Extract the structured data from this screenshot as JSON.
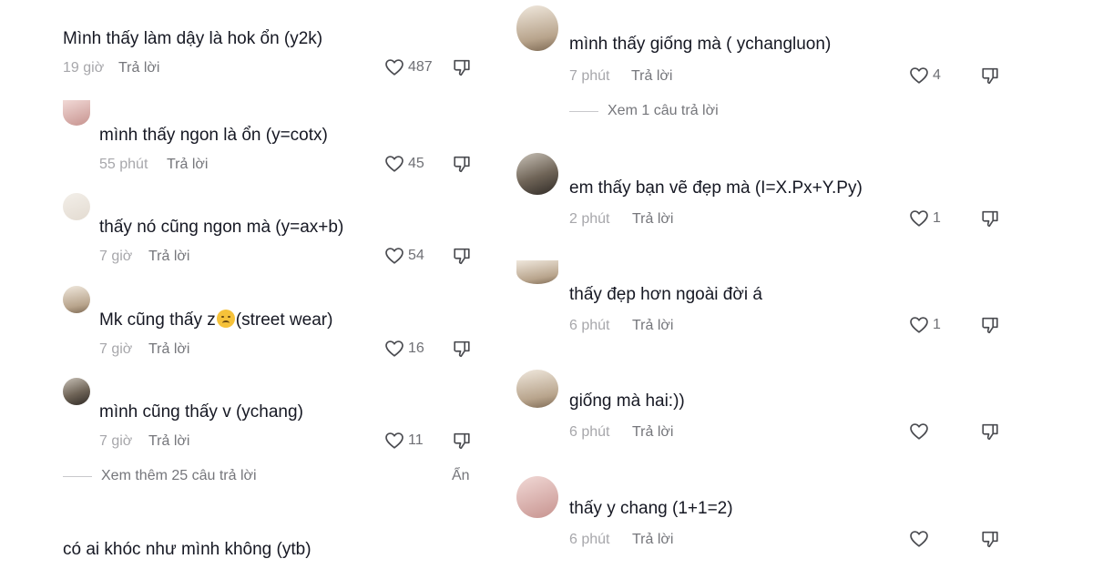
{
  "left": {
    "comments": [
      {
        "text": "Mình thấy làm dậy là hok ổn (y2k)",
        "time": "19 giờ",
        "reply": "Trả lời",
        "likes": "487"
      },
      {
        "text": "mình thấy ngon là ổn (y=cotx)",
        "time": "55 phút",
        "reply": "Trả lời",
        "likes": "45"
      },
      {
        "text": "thấy nó cũng ngon mà (y=ax+b)",
        "time": "7 giờ",
        "reply": "Trả lời",
        "likes": "54"
      },
      {
        "text_before": "Mk cũng thấy z",
        "text_after": "(street wear)",
        "emoji": "disappointed-face",
        "time": "7 giờ",
        "reply": "Trả lời",
        "likes": "16"
      },
      {
        "text": "mình cũng thấy v (ychang)",
        "time": "7 giờ",
        "reply": "Trả lời",
        "likes": "11"
      }
    ],
    "view_more": "Xem thêm 25 câu trả lời",
    "hide": "Ẩn",
    "bottom_comment": {
      "text": "có ai khóc như mình không (ytb)"
    }
  },
  "right": {
    "comments": [
      {
        "text": "mình thấy giống mà ( ychangluon)",
        "time": "7 phút",
        "reply": "Trả lời",
        "likes": "4"
      },
      {
        "text": "em thấy bạn vẽ đẹp mà (I=X.Px+Y.Py)",
        "time": "2 phút",
        "reply": "Trả lời",
        "likes": "1"
      },
      {
        "text": "thấy đẹp hơn ngoài đời á",
        "time": "6 phút",
        "reply": "Trả lời",
        "likes": "1"
      },
      {
        "text": "giống mà hai:))",
        "time": "6 phút",
        "reply": "Trả lời",
        "likes": ""
      },
      {
        "text": "thấy y chang (1+1=2)",
        "time": "6 phút",
        "reply": "Trả lời",
        "likes": ""
      }
    ],
    "view_replies": "Xem 1 câu trả lời"
  },
  "icons": {
    "like": "heart-outline-icon",
    "dislike": "thumbs-down-icon"
  },
  "colors": {
    "text": "#161823",
    "meta": "#a7a7ab",
    "reply": "#75767b"
  }
}
